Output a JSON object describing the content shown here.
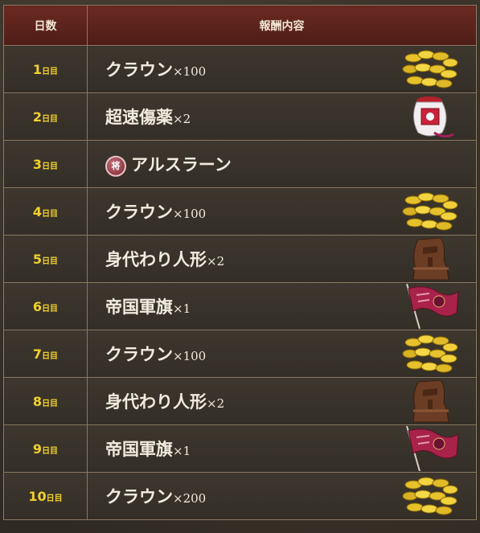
{
  "header": {
    "day_col": "日数",
    "reward_col": "報酬内容"
  },
  "day_suffix": "日目",
  "rows": [
    {
      "day": "1",
      "name": "クラウン",
      "multiplier": "×",
      "qty": "100",
      "icon": "gold-coins-icon",
      "type": "coins"
    },
    {
      "day": "2",
      "name": "超速傷薬",
      "multiplier": "×",
      "qty": "2",
      "icon": "medicine-jar-icon",
      "type": "jar"
    },
    {
      "day": "3",
      "badge": "将",
      "name": "アルスラーン",
      "multiplier": "",
      "qty": "",
      "icon": "",
      "type": "none"
    },
    {
      "day": "4",
      "name": "クラウン",
      "multiplier": "×",
      "qty": "100",
      "icon": "gold-coins-icon",
      "type": "coins"
    },
    {
      "day": "5",
      "name": "身代わり人形",
      "multiplier": "×",
      "qty": "2",
      "icon": "stone-doll-icon",
      "type": "doll"
    },
    {
      "day": "6",
      "name": "帝国軍旗",
      "multiplier": "×",
      "qty": "1",
      "icon": "war-banner-icon",
      "type": "banner"
    },
    {
      "day": "7",
      "name": "クラウン",
      "multiplier": "×",
      "qty": "100",
      "icon": "gold-coins-icon",
      "type": "coins"
    },
    {
      "day": "8",
      "name": "身代わり人形",
      "multiplier": "×",
      "qty": "2",
      "icon": "stone-doll-icon",
      "type": "doll"
    },
    {
      "day": "9",
      "name": "帝国軍旗",
      "multiplier": "×",
      "qty": "1",
      "icon": "war-banner-icon",
      "type": "banner"
    },
    {
      "day": "10",
      "name": "クラウン",
      "multiplier": "×",
      "qty": "200",
      "icon": "gold-coins-icon",
      "type": "coins"
    }
  ],
  "colors": {
    "day_number": "#f2d12b",
    "header_bg": "#5a221c",
    "grid_line": "#8b7a62"
  }
}
